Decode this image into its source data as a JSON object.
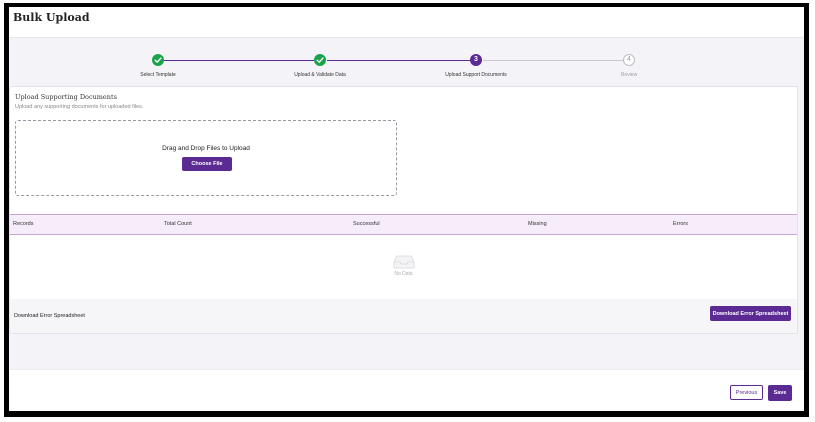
{
  "header": {
    "title": "Bulk Upload"
  },
  "stepper": {
    "steps": [
      {
        "label": "Select Template",
        "state": "done",
        "number": ""
      },
      {
        "label": "Upload & Validate Data",
        "state": "done",
        "number": ""
      },
      {
        "label": "Upload Support Documents",
        "state": "active",
        "number": "3"
      },
      {
        "label": "Review",
        "state": "pending",
        "number": "4"
      }
    ]
  },
  "upload": {
    "title": "Upload Supporting Documents",
    "subtitle": "Upload any supporting documents for uploaded files.",
    "drop_text": "Drag and Drop Files to Upload",
    "choose_label": "Choose File"
  },
  "table": {
    "columns": [
      "Records",
      "Total Count",
      "Successful",
      "Missing",
      "Errors"
    ],
    "empty_text": "No Data"
  },
  "error_bar": {
    "label": "Download Error Spreadsheet",
    "button_label": "Download Error Spreadsheet"
  },
  "footer": {
    "previous_label": "Previous",
    "save_label": "Save"
  },
  "colors": {
    "accent": "#5b2a92",
    "success": "#1aa34a",
    "table_header_bg": "#f7ecf9"
  }
}
